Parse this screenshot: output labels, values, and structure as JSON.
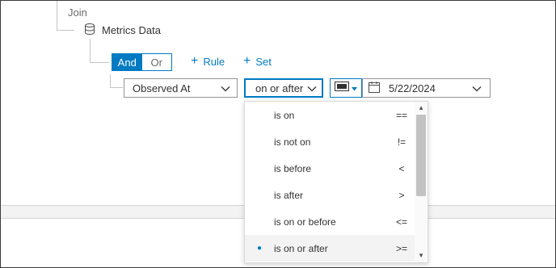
{
  "tree": {
    "join_label": "Join",
    "source_label": "Metrics Data"
  },
  "logic": {
    "options": [
      "And",
      "Or"
    ],
    "selected": "And"
  },
  "actions": {
    "add_rule": "Rule",
    "add_set": "Set"
  },
  "rule": {
    "field": "Observed At",
    "operator": "on or after",
    "date_value": "5/22/2024"
  },
  "operator_menu": {
    "items": [
      {
        "label": "is on",
        "symbol": "=="
      },
      {
        "label": "is not on",
        "symbol": "!="
      },
      {
        "label": "is before",
        "symbol": "<"
      },
      {
        "label": "is after",
        "symbol": ">"
      },
      {
        "label": "is on or before",
        "symbol": "<="
      },
      {
        "label": "is on or after",
        "symbol": ">="
      }
    ],
    "selected_index": 5
  },
  "colors": {
    "accent": "#007ac2"
  }
}
